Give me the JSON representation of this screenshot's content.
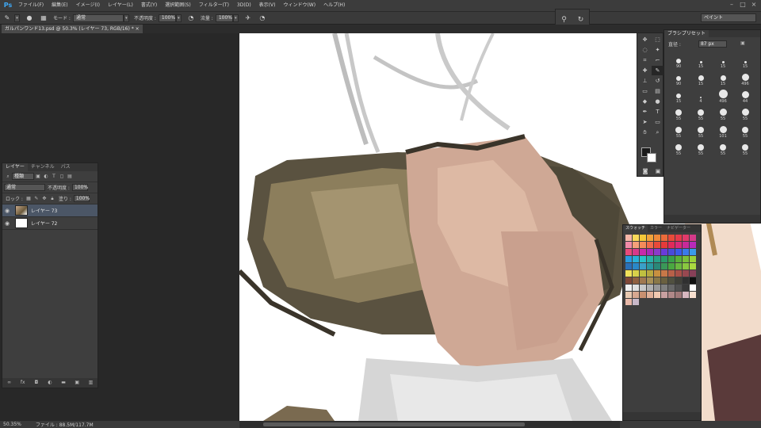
{
  "app": {
    "logo": "Ps",
    "menus": [
      "ファイル(F)",
      "編集(E)",
      "イメージ(I)",
      "レイヤー(L)",
      "書式(Y)",
      "選択範囲(S)",
      "フィルター(T)",
      "3D(D)",
      "表示(V)",
      "ウィンドウ(W)",
      "ヘルプ(H)"
    ],
    "window_controls": [
      "–",
      "□",
      "×"
    ]
  },
  "options_bar": {
    "mode_label": "モード :",
    "mode_value": "通常",
    "opacity_label": "不透明度 :",
    "opacity_value": "100%",
    "flow_label": "流量 :",
    "flow_value": "100%",
    "workspace": "ペイント"
  },
  "document": {
    "tab_title": "ガルパンワンド13.psd @ 50.3% (レイヤー 73, RGB/16) * ×"
  },
  "layers_panel": {
    "tabs": [
      "レイヤー",
      "チャンネル",
      "パス"
    ],
    "filter_label": "種類",
    "blend_mode": "通常",
    "opacity_label": "不透明度 :",
    "opacity_value": "100%",
    "lock_label": "ロック :",
    "fill_label": "塗り :",
    "fill_value": "100%",
    "layers": [
      {
        "name": "レイヤー 73",
        "selected": true
      },
      {
        "name": "レイヤー 72",
        "selected": false
      }
    ],
    "footer_icons": [
      "link-icon",
      "fx-icon",
      "mask-icon",
      "adjust-icon",
      "folder-icon",
      "new-layer-icon",
      "trash-icon"
    ]
  },
  "brush_panel": {
    "title": "ブラシプリセット",
    "size_label": "直径 :",
    "size_value": "87 px",
    "brushes": [
      {
        "num": "90",
        "d": 6
      },
      {
        "num": "15",
        "d": 3
      },
      {
        "num": "15",
        "d": 3
      },
      {
        "num": "15",
        "d": 3
      },
      {
        "num": "90",
        "d": 6
      },
      {
        "num": "15",
        "d": 7
      },
      {
        "num": "15",
        "d": 7
      },
      {
        "num": "496",
        "d": 9
      },
      {
        "num": "15",
        "d": 6
      },
      {
        "num": "4",
        "d": 2
      },
      {
        "num": "496",
        "d": 11
      },
      {
        "num": "44",
        "d": 9
      },
      {
        "num": "55",
        "d": 8
      },
      {
        "num": "55",
        "d": 8
      },
      {
        "num": "55",
        "d": 9
      },
      {
        "num": "55",
        "d": 9
      },
      {
        "num": "55",
        "d": 8
      },
      {
        "num": "55",
        "d": 8
      },
      {
        "num": "101",
        "d": 9
      },
      {
        "num": "55",
        "d": 8
      },
      {
        "num": "55",
        "d": 8
      },
      {
        "num": "55",
        "d": 8
      },
      {
        "num": "55",
        "d": 8
      },
      {
        "num": "55",
        "d": 8
      }
    ]
  },
  "swatch_panel": {
    "tabs": [
      "スウォッチ",
      "カラー",
      "ナビゲーター"
    ],
    "colors": [
      "#f6b6a8",
      "#f9d95a",
      "#f5c83a",
      "#f1a33c",
      "#ef8a3a",
      "#ec6b3a",
      "#e84a3a",
      "#e63a4a",
      "#e23a6a",
      "#d53a8a",
      "#f08aa8",
      "#f5a07a",
      "#f58b5a",
      "#ef6b4a",
      "#e94a3a",
      "#e53a3a",
      "#e02a5a",
      "#d82a7a",
      "#c82a9a",
      "#b82aba",
      "#e84a7a",
      "#d83a8a",
      "#c82aaa",
      "#a82aba",
      "#8a3aca",
      "#6a3ada",
      "#4a4ada",
      "#3a5aea",
      "#3a7aea",
      "#3a9aea",
      "#2a9ae0",
      "#2ab0d8",
      "#2ac0c8",
      "#2ab0a8",
      "#2aa088",
      "#2a9a6a",
      "#3aa04a",
      "#5ab03a",
      "#7ac03a",
      "#9ad03a",
      "#2a70b8",
      "#2a88c8",
      "#3aa0c8",
      "#2a98a0",
      "#2a8878",
      "#3a9858",
      "#4aa840",
      "#6ab840",
      "#8ac840",
      "#aad840",
      "#f0e05a",
      "#d8d04a",
      "#c0c040",
      "#b8a840",
      "#c89040",
      "#c87848",
      "#b86048",
      "#a85048",
      "#984850",
      "#884058",
      "#804838",
      "#906040",
      "#a07850",
      "#a89058",
      "#8a7848",
      "#6a6040",
      "#505040",
      "#404038",
      "#303030",
      "#101010",
      "#f0f0f0",
      "#e0e0e0",
      "#c8c8c8",
      "#b0b0b0",
      "#989898",
      "#808080",
      "#686868",
      "#505050",
      "#383838",
      "#ffffff",
      "#e8c8b0",
      "#d8a890",
      "#c89070",
      "#e0b098",
      "#f0c8b0",
      "#c8a0a0",
      "#b08888",
      "#a07878",
      "#d8b8c0",
      "#f8e0d0",
      "#e8b8a8",
      "#c8b8c8"
    ]
  },
  "status": {
    "zoom": "50.35%",
    "file_info": "ファイル : 88.5M/117.7M"
  }
}
